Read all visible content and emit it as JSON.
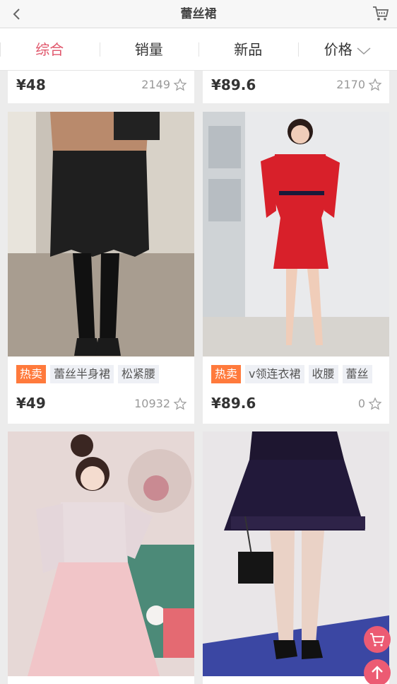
{
  "header": {
    "title": "蕾丝裙",
    "back_icon": "chevron-left-icon",
    "cart_icon": "cart-icon"
  },
  "tabs": [
    {
      "label": "综合",
      "active": true
    },
    {
      "label": "销量",
      "active": false
    },
    {
      "label": "新品",
      "active": false
    },
    {
      "label": "价格",
      "active": false,
      "icon": "chevron-down-icon"
    }
  ],
  "products": [
    {
      "price": "¥48",
      "sales": "2149"
    },
    {
      "price": "¥89.6",
      "sales": "2170"
    },
    {
      "tags": [
        "热卖",
        "蕾丝半身裙",
        "松紧腰"
      ],
      "price": "¥49",
      "sales": "10932",
      "image": "black-lace-skirt-photo"
    },
    {
      "tags": [
        "热卖",
        "v领连衣裙",
        "收腰",
        "蕾丝"
      ],
      "price": "¥89.6",
      "sales": "0",
      "image": "red-lace-dress-photo"
    },
    {
      "image": "pink-lace-dress-photo"
    },
    {
      "image": "navy-skater-skirt-photo"
    }
  ],
  "colors": {
    "accent": "#e0566b",
    "hot_tag": "#ff7a3c",
    "fab": "#ec5b73"
  },
  "floating": {
    "cart_icon": "cart-icon",
    "top_icon": "arrow-up-icon"
  }
}
